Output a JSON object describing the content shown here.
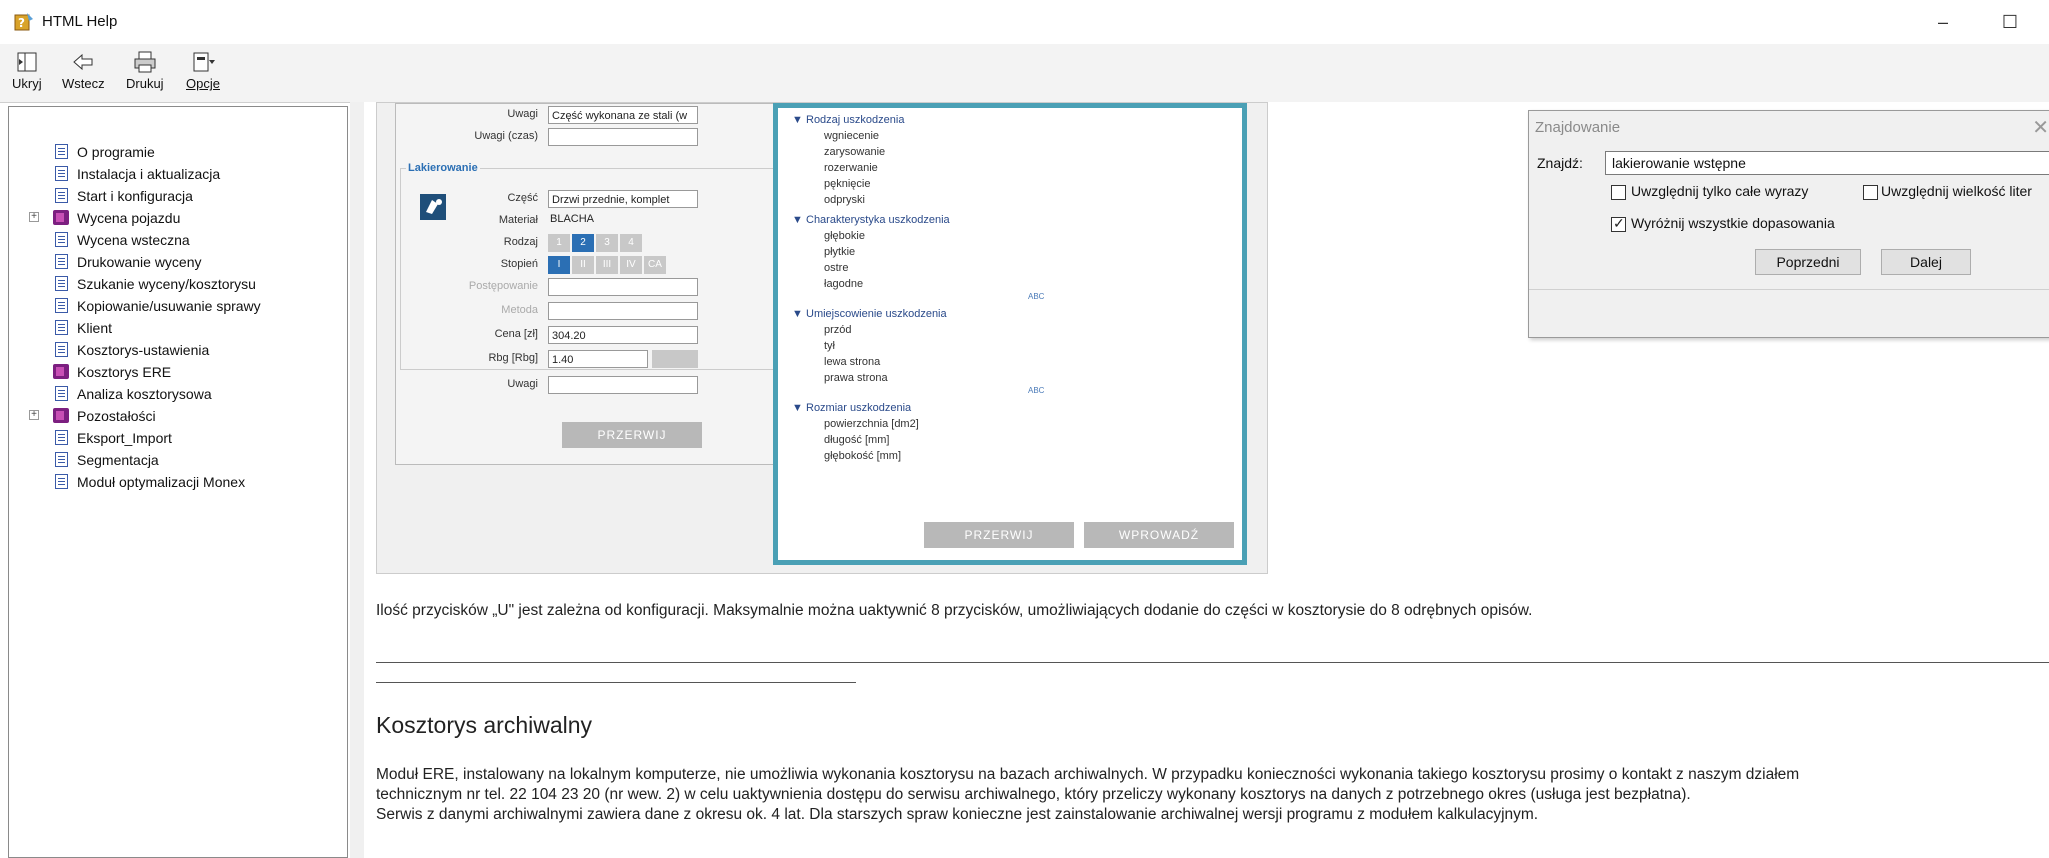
{
  "window": {
    "title": "HTML Help",
    "minimize": "–",
    "maximize": "☐"
  },
  "toolbar": {
    "hide": "Ukryj",
    "back": "Wstecz",
    "print": "Drukuj",
    "options": "Opcje"
  },
  "tree": [
    {
      "label": "O programie",
      "type": "page",
      "expander": ""
    },
    {
      "label": "Instalacja i aktualizacja",
      "type": "page",
      "expander": ""
    },
    {
      "label": "Start i konfiguracja",
      "type": "page",
      "expander": ""
    },
    {
      "label": "Wycena pojazdu",
      "type": "book",
      "expander": "+"
    },
    {
      "label": "Wycena wsteczna",
      "type": "page",
      "expander": ""
    },
    {
      "label": "Drukowanie wyceny",
      "type": "page",
      "expander": ""
    },
    {
      "label": "Szukanie wyceny/kosztorysu",
      "type": "page",
      "expander": ""
    },
    {
      "label": "Kopiowanie/usuwanie sprawy",
      "type": "page",
      "expander": ""
    },
    {
      "label": "Klient",
      "type": "page",
      "expander": ""
    },
    {
      "label": "Kosztorys-ustawienia",
      "type": "page",
      "expander": ""
    },
    {
      "label": "Kosztorys ERE",
      "type": "book",
      "expander": ""
    },
    {
      "label": "Analiza kosztorysowa",
      "type": "page",
      "expander": ""
    },
    {
      "label": "Pozostałości",
      "type": "book",
      "expander": "+"
    },
    {
      "label": "Eksport_Import",
      "type": "page",
      "expander": ""
    },
    {
      "label": "Segmentacja",
      "type": "page",
      "expander": ""
    },
    {
      "label": "Moduł optymalizacji Monex",
      "type": "page",
      "expander": ""
    }
  ],
  "screenshot": {
    "form": {
      "uwagi_label": "Uwagi",
      "uwagi_value": "Część wykonana ze stali (w",
      "uwagi_czas_label": "Uwagi (czas)",
      "section": "Lakierowanie",
      "czesc_label": "Część",
      "czesc_value": "Drzwi przednie, komplet",
      "material_label": "Materiał",
      "material_value": "BLACHA",
      "rodzaj_label": "Rodzaj",
      "rodzaj_options": [
        "1",
        "2",
        "3",
        "4"
      ],
      "stopien_label": "Stopień",
      "stopien_options": [
        "I",
        "II",
        "III",
        "IV",
        "CA"
      ],
      "postepowanie_label": "Postępowanie",
      "metoda_label": "Metoda",
      "cena_label": "Cena [zł]",
      "cena_value": "304.20",
      "rbg_label": "Rbg [Rbg]",
      "rbg_value": "1.40",
      "uwagi2_label": "Uwagi",
      "button": "PRZERWIJ"
    },
    "panel": {
      "groups": [
        {
          "title": "Rodzaj uszkodzenia",
          "items": [
            "wgniecenie",
            "zarysowanie",
            "rozerwanie",
            "pęknięcie",
            "odpryski"
          ]
        },
        {
          "title": "Charakterystyka uszkodzenia",
          "items": [
            "głębokie",
            "płytkie",
            "ostre",
            "łagodne"
          ]
        },
        {
          "title": "Umiejscowienie uszkodzenia",
          "items": [
            "przód",
            "tył",
            "lewa strona",
            "prawa strona"
          ]
        },
        {
          "title": "Rozmiar uszkodzenia",
          "items": [
            "powierzchnia [dm2]",
            "długość [mm]",
            "głębokość [mm]"
          ]
        }
      ],
      "abc": "ABC",
      "btn_cancel": "PRZERWIJ",
      "btn_enter": "WPROWADŹ"
    }
  },
  "content": {
    "para1": "Ilość przycisków „U\" jest zależna od konfiguracji. Maksymalnie można uaktywnić 8 przycisków, umożliwiających dodanie do części w kosztorysie do 8 odrębnych opisów.",
    "heading": "Kosztorys archiwalny",
    "para2_line1": "Moduł ERE, instalowany na lokalnym komputerze, nie umożliwia wykonania kosztorysu na bazach archiwalnych. W przypadku konieczności wykonania takiego kosztorysu prosimy o kontakt z naszym działem",
    "para2_line2": "technicznym nr tel. 22  104 23 20 (nr wew. 2) w celu uaktywnienia dostępu do serwisu archiwalnego, który przeliczy wykonany kosztorys na danych z potrzebnego okres (usługa jest bezpłatna).",
    "para2_line3": "Serwis z danymi archiwalnymi zawiera dane z okresu ok. 4 lat. Dla starszych spraw konieczne jest zainstalowanie archiwalnej wersji programu z modułem kalkulacyjnym."
  },
  "find_dialog": {
    "title": "Znajdowanie",
    "close": "✕",
    "label": "Znajdź:",
    "value": "lakierowanie wstępne",
    "whole_words": "Uwzględnij tylko całe wyrazy",
    "match_case": "Uwzględnij wielkość liter",
    "highlight_all": "Wyróżnij wszystkie dopasowania",
    "prev": "Poprzedni",
    "next": "Dalej"
  }
}
